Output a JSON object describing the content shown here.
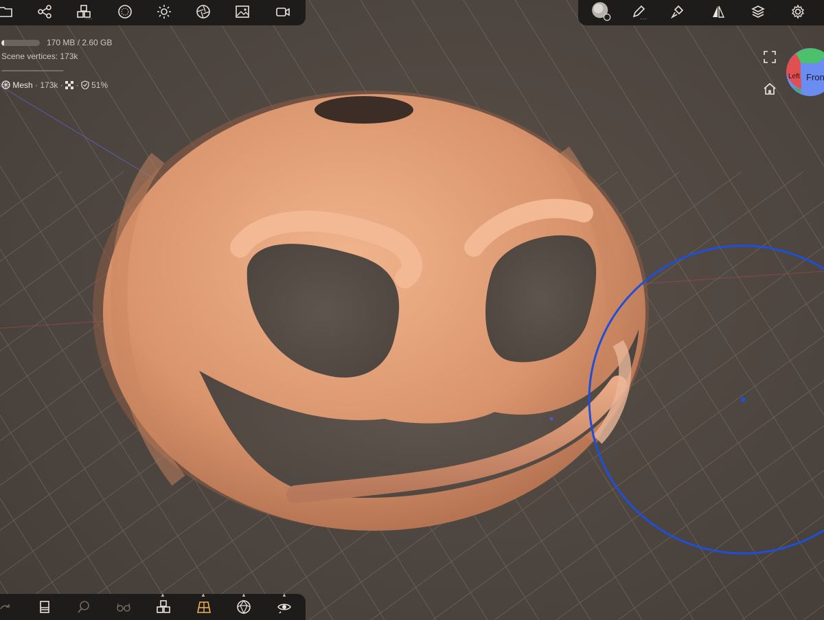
{
  "toolbar_top_left": {
    "items": [
      {
        "name": "files-icon"
      },
      {
        "name": "scene-graph-icon"
      },
      {
        "name": "tools-cubes-icon"
      },
      {
        "name": "matcap-sphere-icon"
      },
      {
        "name": "light-sun-icon"
      },
      {
        "name": "shading-aperture-icon"
      },
      {
        "name": "image-icon"
      },
      {
        "name": "camera-icon"
      }
    ],
    "more_indicator": "..."
  },
  "toolbar_top_right": {
    "items": [
      {
        "name": "brush-settings-icon"
      },
      {
        "name": "pencil-icon"
      },
      {
        "name": "paint-brush-icon"
      },
      {
        "name": "symmetry-icon"
      },
      {
        "name": "layers-icon"
      },
      {
        "name": "settings-gear-icon"
      }
    ],
    "more_indicator": "..."
  },
  "stats": {
    "memory": "170 MB / 2.60 GB",
    "memory_used_fraction": 0.065,
    "scene_vertices_label": "Scene vertices",
    "scene_vertices_value": "173k",
    "separator": "------------------------------",
    "mesh_name": "Mesh",
    "mesh_vertices": "173k",
    "mesh_opacity": "51%"
  },
  "view_controls": {
    "frame_icon": "frame-corners-icon",
    "home_icon": "home-icon"
  },
  "gizmo": {
    "front_label": "Front",
    "left_label": "Left",
    "colors": {
      "front": "#6b8cf0",
      "left": "#e05050",
      "top": "#4cc06a"
    }
  },
  "toolbar_bottom": {
    "items": [
      {
        "name": "redo-icon"
      },
      {
        "name": "material-icon"
      },
      {
        "name": "search-icon"
      },
      {
        "name": "glasses-icon"
      },
      {
        "name": "voxel-cubes-icon"
      },
      {
        "name": "grid-floor-icon"
      },
      {
        "name": "wireframe-icon"
      },
      {
        "name": "eye-visibility-icon"
      }
    ]
  },
  "colors": {
    "background": "#4e4640",
    "toolbar": "#1e1c1b",
    "pumpkin": "#d9946c",
    "cursor_ring": "#1f4fd6",
    "active_tool": "#f0b35a"
  }
}
